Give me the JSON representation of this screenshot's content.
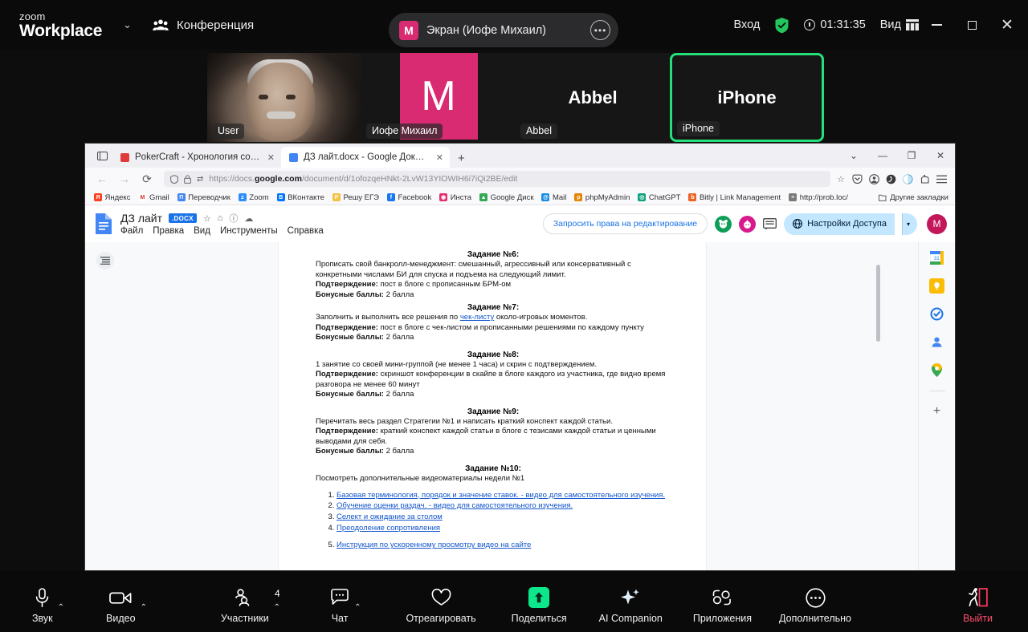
{
  "zoom_top": {
    "logo_line1": "zoom",
    "logo_line2": "Workplace",
    "chevron": "⌄",
    "conference_label": "Конференция",
    "screen_pill": {
      "badge": "M",
      "text": "Экран (Иофе Михаил)",
      "dots": "•••"
    },
    "login_label": "Вход",
    "timer": "01:31:35",
    "view_label": "Вид",
    "win_min": "—",
    "win_max": "□",
    "win_close": "✕"
  },
  "participants": [
    {
      "name": "User",
      "type": "video",
      "big": ""
    },
    {
      "name": "Иофе Михаил",
      "type": "avatar",
      "big": "M",
      "color": "#d92b72"
    },
    {
      "name": "Abbel",
      "type": "name",
      "big": "Abbel"
    },
    {
      "name": "iPhone",
      "type": "name",
      "big": "iPhone",
      "active": true
    }
  ],
  "browser": {
    "tabs": [
      {
        "title": "PokerCraft - Хронология собы",
        "color": "#e03b3b",
        "active": false,
        "close": "✕"
      },
      {
        "title": "ДЗ лайт.docx - Google Докуме",
        "color": "#4285f4",
        "active": true,
        "close": "✕"
      }
    ],
    "new_tab": "+",
    "win_controls": {
      "chevron": "⌄",
      "min": "—",
      "max": "❐",
      "close": "✕"
    },
    "nav": {
      "back": "←",
      "forward": "→",
      "reload": "⟳"
    },
    "url": {
      "prefix": "https://docs.",
      "domain": "google.com",
      "suffix": "/document/d/1ofozqeHNkt-2LvW13YIOWIH6i7iQi2BE/edit",
      "full": "https://docs.google.com/document/d/1ofozqeHNkt-2LvW13YIOWIH6i7iQi2BE/edit",
      "star": "☆"
    },
    "bookmarks": [
      {
        "label": "Яндекс",
        "color": "#fc3f1d",
        "glyph": "Я"
      },
      {
        "label": "Gmail",
        "color": "#ffffff",
        "glyph": "M"
      },
      {
        "label": "Переводчик",
        "color": "#4285f4",
        "glyph": "П"
      },
      {
        "label": "Zoom",
        "color": "#2d8cff",
        "glyph": "z"
      },
      {
        "label": "ВКонтакте",
        "color": "#0077ff",
        "glyph": "B"
      },
      {
        "label": "Решу ЕГЭ",
        "color": "#f5c242",
        "glyph": "Р"
      },
      {
        "label": "Facebook",
        "color": "#1877f2",
        "glyph": "f"
      },
      {
        "label": "Инста",
        "color": "#e1306c",
        "glyph": "◉"
      },
      {
        "label": "Google Диск",
        "color": "#34a853",
        "glyph": "▲"
      },
      {
        "label": "Mail",
        "color": "#168de2",
        "glyph": "@"
      },
      {
        "label": "phpMyAdmin",
        "color": "#e48400",
        "glyph": "p"
      },
      {
        "label": "ChatGPT",
        "color": "#10a37f",
        "glyph": "◎"
      },
      {
        "label": "Bitly | Link Management",
        "color": "#ee6123",
        "glyph": "b"
      },
      {
        "label": "http://prob.loc/",
        "color": "#7a7a7a",
        "glyph": "≡"
      }
    ],
    "other_bookmarks": "Другие закладки"
  },
  "gdocs": {
    "title": "ДЗ лайт",
    "badge": ".DOCX",
    "header_icons": [
      "star-icon",
      "move-to-drive-icon",
      "document-status-icon",
      "cloud-icon"
    ],
    "menu": [
      "Файл",
      "Правка",
      "Вид",
      "Инструменты",
      "Справка"
    ],
    "request_access": "Запросить права на редактирование",
    "share_button": "Настройки Доступа",
    "share_caret": "▾",
    "profile_initial": "M",
    "avatars": [
      {
        "initial": "",
        "color": "#0f9d58"
      },
      {
        "initial": "",
        "color": "#d81b8c"
      }
    ],
    "right_rail": [
      {
        "name": "calendar-icon",
        "color": "#1a73e8",
        "glyph": "31"
      },
      {
        "name": "keep-icon",
        "color": "#fbbc04",
        "glyph": "▮"
      },
      {
        "name": "tasks-icon",
        "color": "#1a73e8",
        "glyph": "◷"
      },
      {
        "name": "contacts-icon",
        "color": "#4285f4",
        "glyph": "●"
      },
      {
        "name": "maps-icon",
        "color": "#ea4335",
        "glyph": "◉"
      }
    ],
    "rail_plus": "+"
  },
  "document": {
    "sections": [
      {
        "heading": "Задание №6:",
        "body": "Прописать свой банкролл-менеджмент: смешанный, агрессивный или консервативный с конкретными числами БИ для спуска и подъема на следующий лимит.",
        "confirm_label": "Подтверждение:",
        "confirm_text": " пост в блоге с прописанным БРМ-ом",
        "points_label": "Бонусные баллы:",
        "points_text": " 2 балла"
      },
      {
        "heading": "Задание №7:",
        "body_pre": "Заполнить и выполнить все решения по ",
        "body_link": "чек-листу",
        "body_post": " около-игровых моментов.",
        "confirm_label": "Подтверждение:",
        "confirm_text": " пост в блоге с чек-листом и прописанными решениями по каждому пункту",
        "points_label": "Бонусные баллы:",
        "points_text": " 2 балла"
      },
      {
        "heading": "Задание №8:",
        "body": "1 занятие со своей мини-группой (не менее 1 часа) и скрин с подтверждением.",
        "confirm_label": "Подтверждение:",
        "confirm_text": " скриншот конференции в скайпе в блоге каждого из участника, где видно время разговора не менее 60 минут",
        "points_label": "Бонусные баллы:",
        "points_text": " 2 балла"
      },
      {
        "heading": "Задание №9:",
        "body": "Перечитать весь раздел Стратегии №1 и написать краткий конспект каждой статьи.",
        "confirm_label": "Подтверждение:",
        "confirm_text": " краткий конспект каждой статьи в блоге с тезисами каждой статьи и ценными выводами для себя.",
        "points_label": "Бонусные баллы:",
        "points_text": " 2 балла"
      }
    ],
    "last_heading": "Задание №10:",
    "last_body": "Посмотреть дополнительные видеоматериалы недели №1",
    "links": [
      "Базовая терминология, порядок и значение ставок. - видео для самостоятельного изучения.",
      "Обучение оценки раздач. - видео для самостоятельного изучения.",
      "Селект и ожидание за столом",
      "Преодоление сопротивления",
      "Инструкция по ускоренному просмотру видео на сайте"
    ]
  },
  "zoom_bottom": {
    "items": [
      {
        "label": "Звук",
        "icon": "microphone-icon",
        "caret": "⌃"
      },
      {
        "label": "Видео",
        "icon": "video-camera-icon",
        "caret": "⌃"
      },
      {
        "label": "Участники",
        "icon": "participants-icon",
        "caret": "⌃",
        "count": "4"
      },
      {
        "label": "Чат",
        "icon": "chat-bubble-icon",
        "caret": "⌃"
      },
      {
        "label": "Отреагировать",
        "icon": "heart-icon"
      },
      {
        "label": "Поделиться",
        "icon": "share-screen-icon"
      },
      {
        "label": "AI Companion",
        "icon": "sparkle-icon"
      },
      {
        "label": "Приложения",
        "icon": "apps-icon"
      },
      {
        "label": "Дополнительно",
        "icon": "more-dots-icon"
      },
      {
        "label": "Выйти",
        "icon": "exit-door-icon"
      }
    ]
  },
  "colors": {
    "accent_green": "#0ce78b",
    "active_border": "#25e07a",
    "pink": "#d92b72",
    "exit_red": "#ff4d6a"
  }
}
